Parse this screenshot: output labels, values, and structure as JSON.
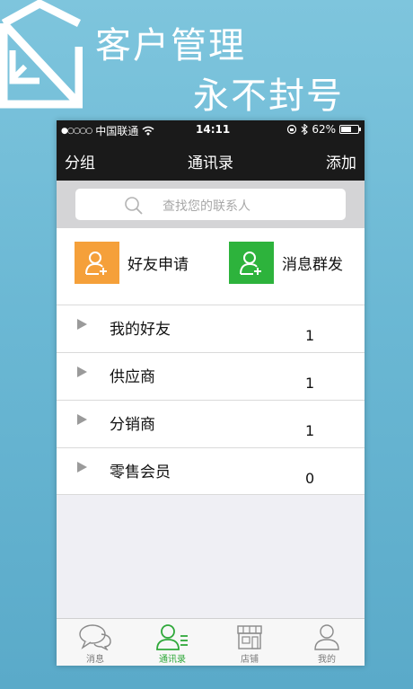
{
  "promo": {
    "title_line1": "客户管理",
    "title_line2": "永不封号"
  },
  "status_bar": {
    "signal": "●○○○○",
    "carrier": "中国联通",
    "time": "14:11",
    "battery_percent": "62%",
    "battery_level": 0.62
  },
  "nav": {
    "left": "分组",
    "title": "通讯录",
    "right": "添加"
  },
  "search": {
    "placeholder": "查找您的联系人"
  },
  "actions": [
    {
      "label": "好友申请",
      "color": "#f5a03a",
      "icon": "add-user-icon"
    },
    {
      "label": "消息群发",
      "color": "#2db33c",
      "icon": "add-user-icon"
    }
  ],
  "groups": [
    {
      "name": "我的好友",
      "count": "1"
    },
    {
      "name": "供应商",
      "count": "1"
    },
    {
      "name": "分销商",
      "count": "1"
    },
    {
      "name": "零售会员",
      "count": "0"
    }
  ],
  "tabs": [
    {
      "label": "消息",
      "icon": "chat-bubbles-icon",
      "active": false
    },
    {
      "label": "通讯录",
      "icon": "contacts-icon",
      "active": true
    },
    {
      "label": "店铺",
      "icon": "store-icon",
      "active": false
    },
    {
      "label": "我的",
      "icon": "profile-icon",
      "active": false
    }
  ],
  "colors": {
    "accent_green": "#2fa83a",
    "accent_orange": "#f5a03a",
    "nav_bg": "#1a1a1a"
  }
}
